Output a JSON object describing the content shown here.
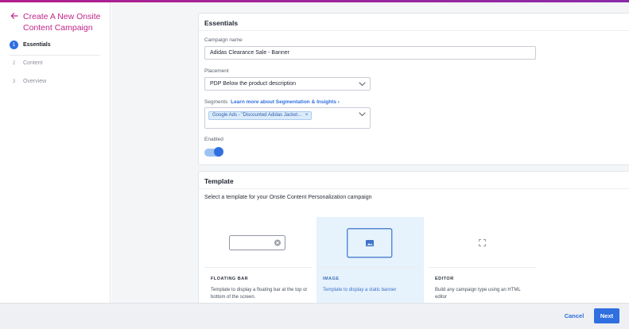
{
  "sidebar": {
    "title": "Create A New Onsite Content Campaign",
    "steps": [
      {
        "num": "1",
        "label": "Essentials",
        "active": true
      },
      {
        "num": "2",
        "label": "Content",
        "active": false
      },
      {
        "num": "3",
        "label": "Overview",
        "active": false
      }
    ]
  },
  "essentials": {
    "title": "Essentials",
    "campaign_name_label": "Campaign name",
    "campaign_name_value": "Adidas Clearance Sale - Banner",
    "placement_label": "Placement",
    "placement_value": "PDP Below the product description",
    "segments_label": "Segments",
    "segments_link": "Learn more about Segmentation & Insights ›",
    "segment_chip": "Google Ads - \"Discounted Adidas Jacket...",
    "segment_chip_remove": "×",
    "enabled_label": "Enabled",
    "enabled": true
  },
  "template": {
    "title": "Template",
    "description": "Select a template for your Onsite Content Personalization campaign",
    "options": [
      {
        "name": "FLOATING BAR",
        "text": "Template to display a floating bar at the top or bottom of the screen.",
        "selected": false
      },
      {
        "name": "IMAGE",
        "text": "Template to display a static banner",
        "selected": true
      },
      {
        "name": "EDITOR",
        "text": "Build any campaign type using an HTML editor",
        "selected": false
      }
    ]
  },
  "footer": {
    "cancel_label": "Cancel",
    "next_label": "Next"
  },
  "colors": {
    "accent": "#2f6fe0",
    "brand": "#c2258a"
  },
  "icons": [
    "back-arrow-icon",
    "chevron-down-icon",
    "close-icon",
    "image-icon",
    "expand-icon"
  ]
}
